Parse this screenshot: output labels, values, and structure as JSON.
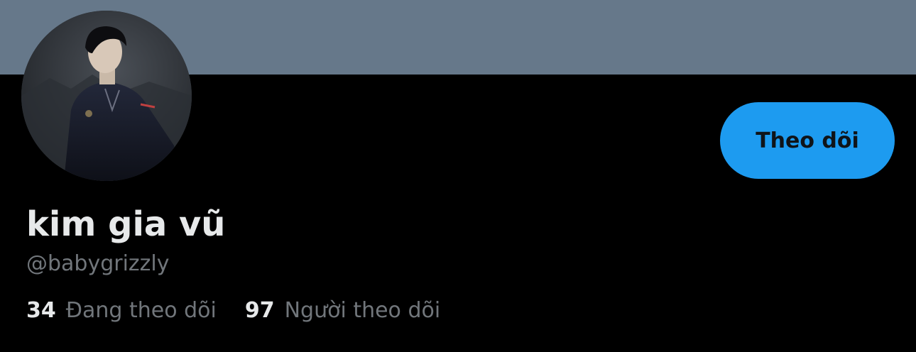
{
  "profile": {
    "display_name": "kim gia vũ",
    "handle": "@babygrizzly",
    "follow_button_label": "Theo dõi",
    "stats": {
      "following_count": "34",
      "following_label": "Đang theo dõi",
      "followers_count": "97",
      "followers_label": "Người theo dõi"
    }
  },
  "colors": {
    "banner": "#66788a",
    "background": "#000000",
    "accent": "#1d9bf0",
    "primary_text": "#e7e9ea",
    "secondary_text": "#71767b"
  }
}
